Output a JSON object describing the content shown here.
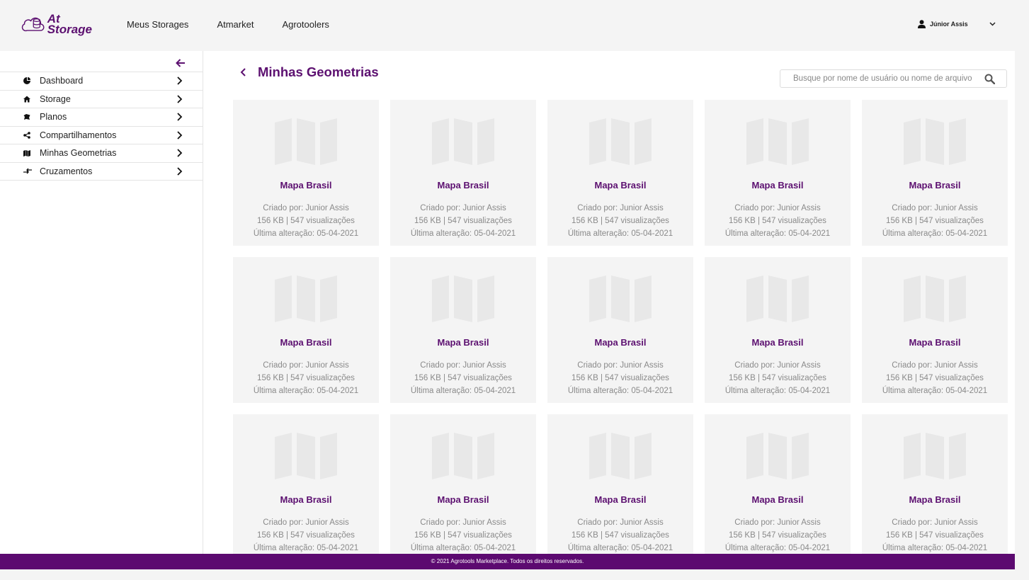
{
  "header": {
    "logo_line1": "At",
    "logo_line2": "Storage",
    "nav": [
      "Meus Storages",
      "Atmarket",
      "Agrotoolers"
    ],
    "user_name": "Júnior Assis"
  },
  "sidebar": {
    "items": [
      {
        "label": "Dashboard",
        "icon": "dashboard-icon"
      },
      {
        "label": "Storage",
        "icon": "home-icon"
      },
      {
        "label": "Planos",
        "icon": "plans-icon"
      },
      {
        "label": "Compartilhamentos",
        "icon": "share-icon"
      },
      {
        "label": "Minhas Geometrias",
        "icon": "map-icon"
      },
      {
        "label": "Cruzamentos",
        "icon": "crossing-icon"
      }
    ]
  },
  "main": {
    "title": "Minhas Geometrias",
    "search_placeholder": "Busque por nome de usuário ou nome de arquivo",
    "cards": [
      {
        "title": "Mapa Brasil",
        "created_by": "Criado por: Junior Assis",
        "stats": "156 KB  | 547 visualizações",
        "modified": "Última alteração: 05-04-2021"
      },
      {
        "title": "Mapa Brasil",
        "created_by": "Criado por: Junior Assis",
        "stats": "156 KB  | 547 visualizações",
        "modified": "Última alteração: 05-04-2021"
      },
      {
        "title": "Mapa Brasil",
        "created_by": "Criado por: Junior Assis",
        "stats": "156 KB  | 547 visualizações",
        "modified": "Última alteração: 05-04-2021"
      },
      {
        "title": "Mapa Brasil",
        "created_by": "Criado por: Junior Assis",
        "stats": "156 KB  | 547 visualizações",
        "modified": "Última alteração: 05-04-2021"
      },
      {
        "title": "Mapa Brasil",
        "created_by": "Criado por: Junior Assis",
        "stats": "156 KB  | 547 visualizações",
        "modified": "Última alteração: 05-04-2021"
      },
      {
        "title": "Mapa Brasil",
        "created_by": "Criado por: Junior Assis",
        "stats": "156 KB  | 547 visualizações",
        "modified": "Última alteração: 05-04-2021"
      },
      {
        "title": "Mapa Brasil",
        "created_by": "Criado por: Junior Assis",
        "stats": "156 KB  | 547 visualizações",
        "modified": "Última alteração: 05-04-2021"
      },
      {
        "title": "Mapa Brasil",
        "created_by": "Criado por: Junior Assis",
        "stats": "156 KB  | 547 visualizações",
        "modified": "Última alteração: 05-04-2021"
      },
      {
        "title": "Mapa Brasil",
        "created_by": "Criado por: Junior Assis",
        "stats": "156 KB  | 547 visualizações",
        "modified": "Última alteração: 05-04-2021"
      },
      {
        "title": "Mapa Brasil",
        "created_by": "Criado por: Junior Assis",
        "stats": "156 KB  | 547 visualizações",
        "modified": "Última alteração: 05-04-2021"
      },
      {
        "title": "Mapa Brasil",
        "created_by": "Criado por: Junior Assis",
        "stats": "156 KB  | 547 visualizações",
        "modified": "Última alteração: 05-04-2021"
      },
      {
        "title": "Mapa Brasil",
        "created_by": "Criado por: Junior Assis",
        "stats": "156 KB  | 547 visualizações",
        "modified": "Última alteração: 05-04-2021"
      },
      {
        "title": "Mapa Brasil",
        "created_by": "Criado por: Junior Assis",
        "stats": "156 KB  | 547 visualizações",
        "modified": "Última alteração: 05-04-2021"
      },
      {
        "title": "Mapa Brasil",
        "created_by": "Criado por: Junior Assis",
        "stats": "156 KB  | 547 visualizações",
        "modified": "Última alteração: 05-04-2021"
      },
      {
        "title": "Mapa Brasil",
        "created_by": "Criado por: Junior Assis",
        "stats": "156 KB  | 547 visualizações",
        "modified": "Última alteração: 05-04-2021"
      }
    ]
  },
  "footer": {
    "text": "© 2021 Agrotools Marketplace. Todos os direitos reservados."
  },
  "colors": {
    "brand": "#5c1070",
    "footer_bg": "#5c0a70",
    "card_bg": "#f4f4f4",
    "meta_text": "#8a8a8a"
  }
}
